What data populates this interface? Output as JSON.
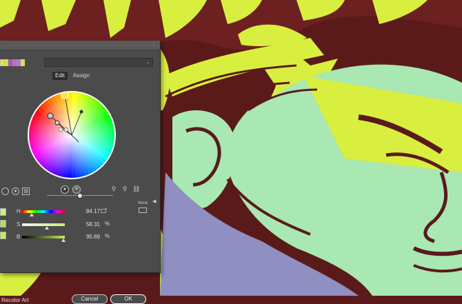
{
  "panel": {
    "tabs": [
      {
        "label": "Edit",
        "active": true
      },
      {
        "label": "Assign",
        "active": false
      }
    ],
    "harmony_swatches": [
      "#f2e84a",
      "#cfe24a",
      "#9a5fb8",
      "#c26bbf",
      "#a77fd0",
      "#e0dc56"
    ],
    "sliders": [
      {
        "label": "H",
        "value": "84.17",
        "unit": "°",
        "position": 0.23
      },
      {
        "label": "S",
        "value": "58.31",
        "unit": "%",
        "position": 0.58
      },
      {
        "label": "B",
        "value": "95.69",
        "unit": "%",
        "position": 0.96
      }
    ],
    "selected_swatches": [
      "#c9f07a",
      "#b6e05c",
      "#c7e860"
    ],
    "none_label": "None",
    "recolor_art_label": "Recolor Art",
    "cancel_label": "Cancel",
    "ok_label": "OK"
  },
  "colors": {
    "panel_bg": "#4b4b4b",
    "art_lime": "#d9ef3f",
    "art_mint": "#a9e7b3",
    "art_maroon": "#5a1a1a",
    "art_lavender": "#8f8fc2"
  }
}
